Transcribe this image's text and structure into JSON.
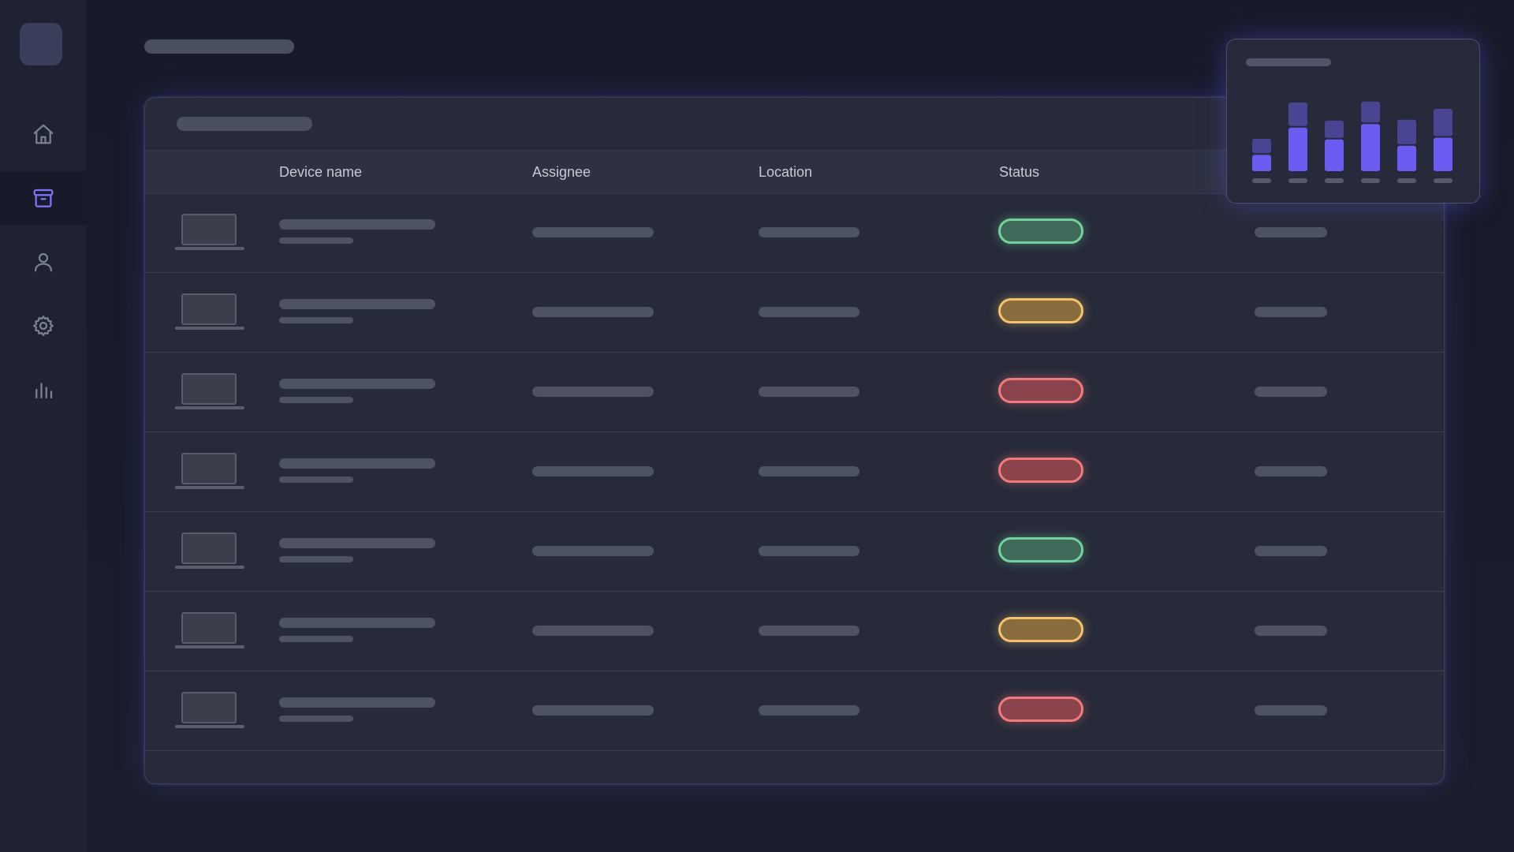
{
  "sidebar": {
    "items": [
      {
        "icon": "home-icon",
        "active": false
      },
      {
        "icon": "archive-box-icon",
        "active": true
      },
      {
        "icon": "user-icon",
        "active": false
      },
      {
        "icon": "gear-icon",
        "active": false
      },
      {
        "icon": "bar-chart-icon",
        "active": false
      }
    ],
    "accent": "#7f74ff"
  },
  "table": {
    "columns": [
      "Device name",
      "Assignee",
      "Location",
      "Status"
    ],
    "rows": [
      {
        "status": "ok"
      },
      {
        "status": "warn"
      },
      {
        "status": "err"
      },
      {
        "status": "err"
      },
      {
        "status": "ok"
      },
      {
        "status": "warn"
      },
      {
        "status": "err"
      }
    ]
  },
  "status_colors": {
    "ok": "#72d39b",
    "warn": "#f2c26c",
    "err": "#f07a7e"
  },
  "chart_data": {
    "type": "bar",
    "stacked": true,
    "categories": [
      "",
      "",
      "",
      "",
      "",
      ""
    ],
    "series": [
      {
        "values": [
          18,
          48,
          35,
          52,
          28,
          37
        ]
      },
      {
        "values": [
          16,
          26,
          19,
          23,
          27,
          30
        ]
      }
    ],
    "ylim": [
      0,
      100
    ],
    "colors": [
      "#6b5cf2",
      "#4a4592"
    ]
  }
}
